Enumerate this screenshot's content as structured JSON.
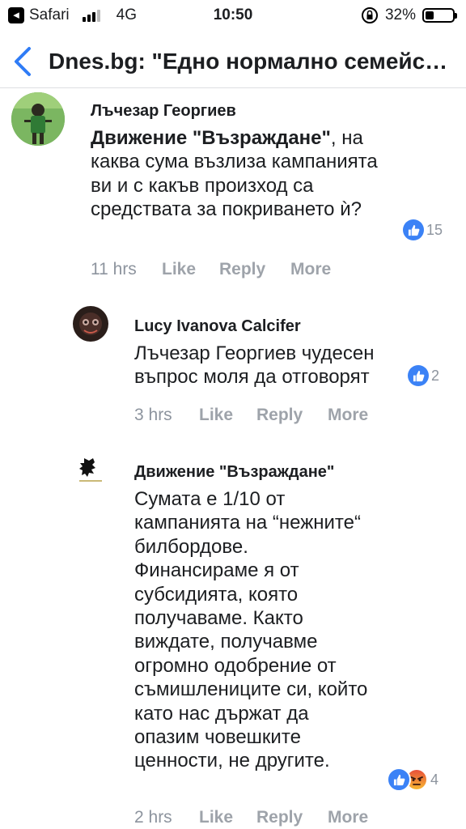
{
  "status_bar": {
    "back_app": "Safari",
    "network": "4G",
    "time": "10:50",
    "battery_percent": "32%",
    "battery_level": 0.32
  },
  "nav": {
    "title": "Dnes.bg: \"Едно нормално семейство...\""
  },
  "comments": [
    {
      "author": "Лъчезар Георгиев",
      "mention": "Движение \"Възраждане\"",
      "text": ", на каква сума възлиза кампанията ви и с какъв произход са средствата за покриването ѝ?",
      "reactions_count": "15",
      "time": "11 hrs",
      "like": "Like",
      "reply": "Reply",
      "more": "More"
    },
    {
      "author": "Lucy Ivanova Calcifer",
      "text": "Лъчезар Георгиев чудесен въпрос моля да отговорят",
      "reactions_count": "2",
      "time": "3 hrs",
      "like": "Like",
      "reply": "Reply",
      "more": "More"
    },
    {
      "author": "Движение \"Възраждане\"",
      "text": "Сумата е 1/10 от кампанията на “нежните“ билбордове. Финансираме я от субсидията, която получаваме. Както виждате, получавме огромно одобрение от съмишлениците си, който като нас държат да опазим човешките ценности, не другите.",
      "reactions_count": "4",
      "time": "2 hrs",
      "like": "Like",
      "reply": "Reply",
      "more": "More"
    }
  ],
  "colors": {
    "like_blue": "#3b82f6",
    "ios_blue": "#2f7cf6",
    "meta_gray": "#8d949e"
  }
}
